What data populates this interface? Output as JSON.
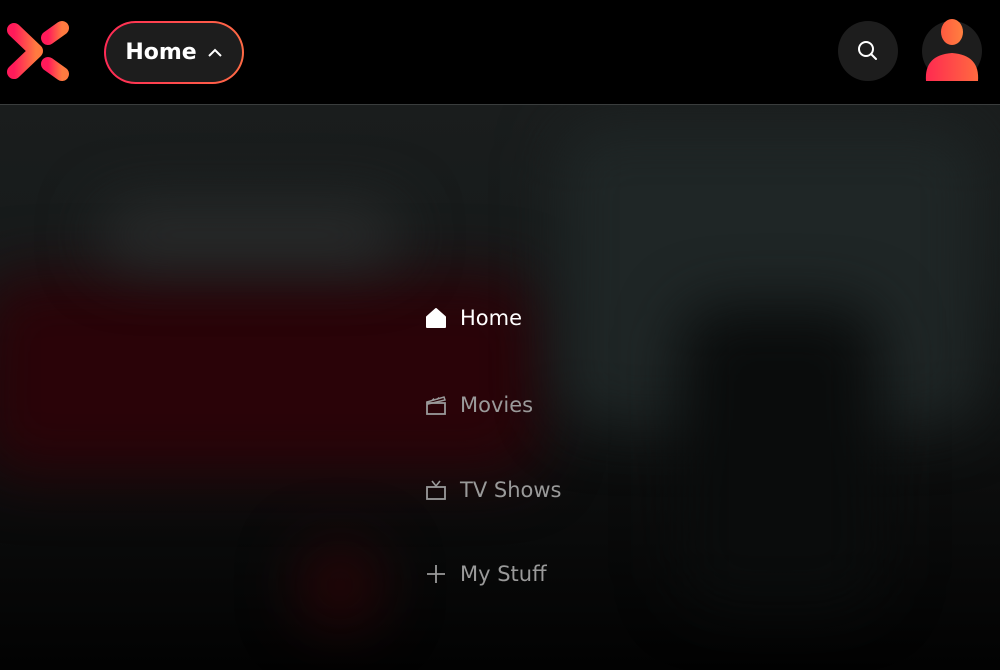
{
  "header": {
    "logo": "x-logo",
    "nav_dropdown_label": "Home",
    "search_icon": "search-icon",
    "avatar_icon": "user-avatar-icon"
  },
  "menu": {
    "items": [
      {
        "label": "Home",
        "icon": "home-icon",
        "active": true
      },
      {
        "label": "Movies",
        "icon": "clapperboard-icon",
        "active": false
      },
      {
        "label": "TV Shows",
        "icon": "tv-icon",
        "active": false
      },
      {
        "label": "My Stuff",
        "icon": "plus-icon",
        "active": false
      }
    ]
  },
  "colors": {
    "accent_start": "#ff2a55",
    "accent_end": "#ff6a45",
    "button_bg": "#1d1d1d"
  }
}
